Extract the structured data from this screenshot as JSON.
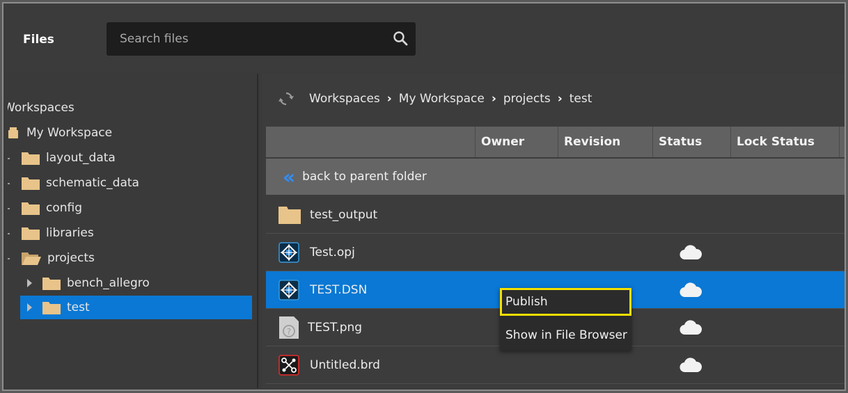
{
  "header": {
    "title": "Files"
  },
  "search": {
    "placeholder": "Search files"
  },
  "tree": {
    "root": "Workspaces",
    "workspace": "My Workspace",
    "folders": [
      "layout_data",
      "schematic_data",
      "config",
      "libraries",
      "projects"
    ],
    "subfolders": [
      "bench_allegro",
      "test"
    ]
  },
  "breadcrumb": [
    "Workspaces",
    "My Workspace",
    "projects",
    "test"
  ],
  "columns": [
    "Owner",
    "Revision",
    "Status",
    "Lock Status"
  ],
  "back": {
    "label": "back to parent folder"
  },
  "files": [
    {
      "name": "test_output",
      "icon": "folder-icon",
      "status": ""
    },
    {
      "name": "Test.opj",
      "icon": "project-file-icon",
      "status": "cloud"
    },
    {
      "name": "TEST.DSN",
      "icon": "design-file-icon",
      "status": "cloud",
      "selected": true
    },
    {
      "name": "TEST.png",
      "icon": "unknown-file-icon",
      "status": "cloud"
    },
    {
      "name": "Untitled.brd",
      "icon": "board-file-icon",
      "status": "cloud"
    }
  ],
  "context_menu": {
    "items": [
      "Publish",
      "Show in File Browser"
    ]
  },
  "colors": {
    "accent": "#0a78d4",
    "highlight": "#f5e000",
    "folder": "#e8c48a"
  }
}
